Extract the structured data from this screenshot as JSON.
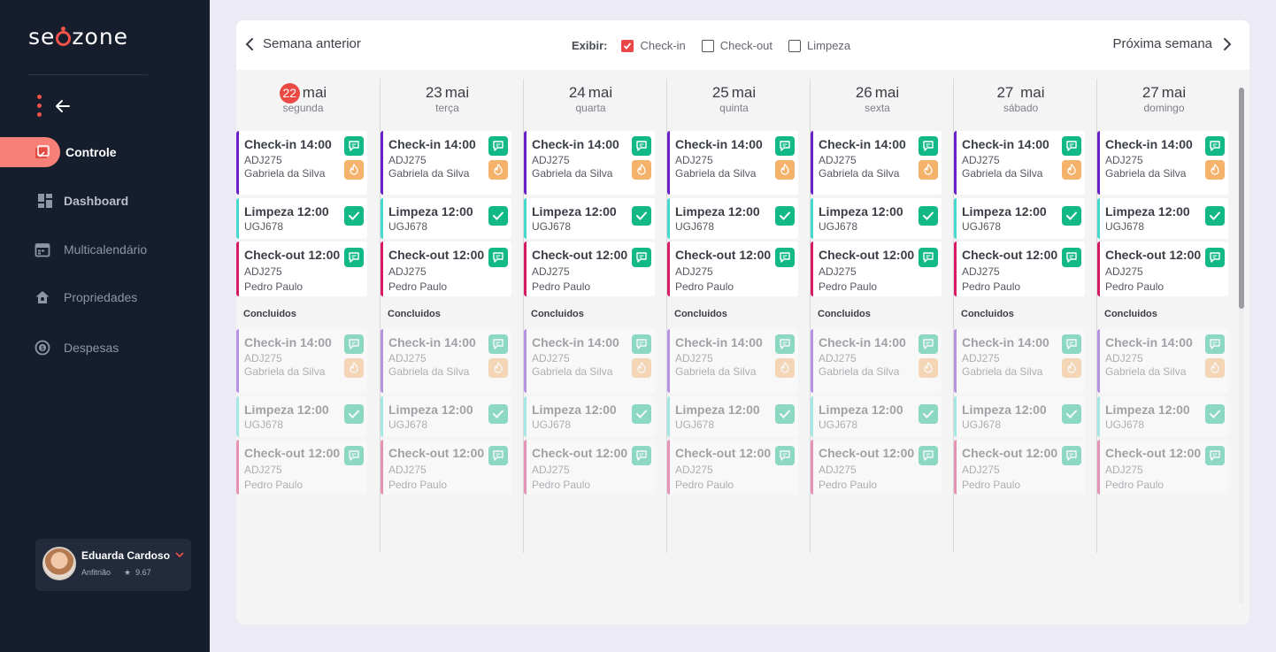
{
  "brand": {
    "logo_text": "seazone",
    "accent": "#f0534a"
  },
  "sidebar": {
    "items": [
      {
        "label": "Controle",
        "icon": "calendar-check-icon",
        "active": true
      },
      {
        "label": "Dashboard",
        "icon": "grid-icon"
      },
      {
        "label": "Multicalendário",
        "icon": "calendar-icon"
      },
      {
        "label": "Propriedades",
        "icon": "house-icon"
      },
      {
        "label": "Despesas",
        "icon": "money-icon"
      }
    ]
  },
  "user": {
    "name": "Eduarda Cardoso",
    "role": "Anfitrião",
    "rating": "9.67"
  },
  "toolbar": {
    "prev_label": "Semana anterior",
    "next_label": "Próxima semana",
    "filter_label": "Exibir:",
    "filters": [
      {
        "label": "Check-in",
        "checked": true
      },
      {
        "label": "Check-out",
        "checked": false
      },
      {
        "label": "Limpeza",
        "checked": false
      }
    ]
  },
  "done_label": "Concluidos",
  "days": [
    {
      "day": "22",
      "month": "mai",
      "weekday": "segunda",
      "today": true
    },
    {
      "day": "23",
      "month": "mai",
      "weekday": "terça"
    },
    {
      "day": "24",
      "month": "mai",
      "weekday": "quarta"
    },
    {
      "day": "25",
      "month": "mai",
      "weekday": "quinta"
    },
    {
      "day": "26",
      "month": "mai",
      "weekday": "sexta"
    },
    {
      "day": "27",
      "month": " mai",
      "weekday": "sábado"
    },
    {
      "day": "27",
      "month": "mai",
      "weekday": "domingo"
    }
  ],
  "cards": {
    "checkin": {
      "title": "Check-in 14:00",
      "code": "ADJ275",
      "guest": "Gabriela da Silva",
      "color": "#6a1fc9"
    },
    "cleaning": {
      "title": "Limpeza 12:00",
      "code": "UGJ678",
      "color": "#45d8cf"
    },
    "checkout": {
      "title": "Check-out 12:00",
      "code": "ADJ275",
      "guest": "Pedro Paulo",
      "color": "#d81b67"
    }
  }
}
